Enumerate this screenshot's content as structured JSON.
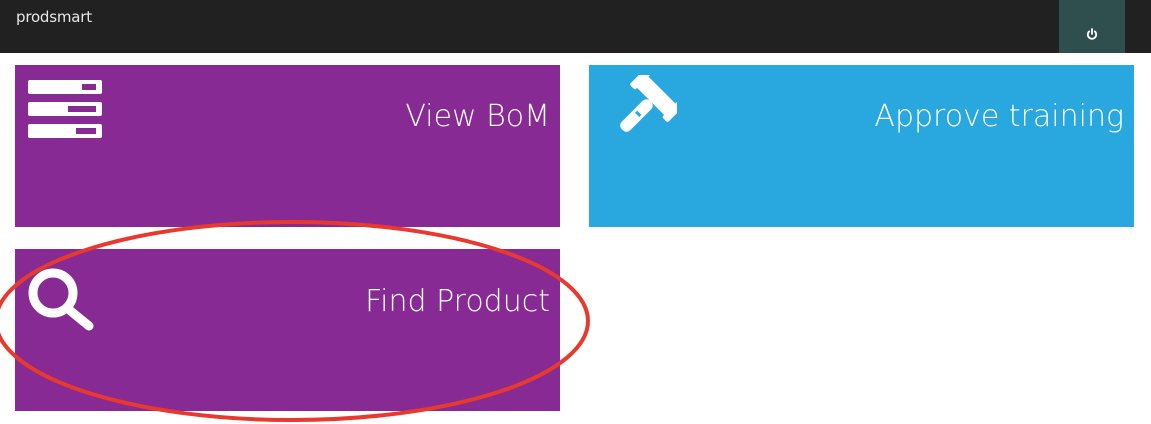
{
  "app": {
    "brand": "prodsmart",
    "power_icon": "power-icon"
  },
  "colors": {
    "topbar": "#212121",
    "power_button": "#2f4f4f",
    "tile_purple": "#882a93",
    "tile_blue": "#29a8e0",
    "annotation": "#e8392e"
  },
  "tiles": [
    {
      "label": "View BoM",
      "icon": "list-icon",
      "color": "#882a93"
    },
    {
      "label": "Approve training",
      "icon": "gavel-icon",
      "color": "#29a8e0"
    },
    {
      "label": "Find Product",
      "icon": "search-icon",
      "color": "#882a93"
    }
  ],
  "annotation": {
    "shape": "ellipse",
    "highlights": "Find Product",
    "color": "#e8392e"
  }
}
